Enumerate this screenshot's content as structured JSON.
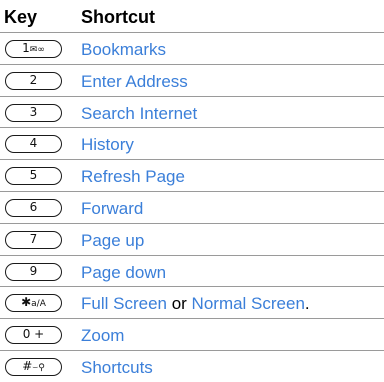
{
  "header": {
    "key_label": "Key",
    "shortcut_label": "Shortcut"
  },
  "rows": [
    {
      "key": "1",
      "key_suffix": "✉∞",
      "shortcut": "Bookmarks"
    },
    {
      "key": "2",
      "shortcut": "Enter Address"
    },
    {
      "key": "3",
      "shortcut": "Search Internet"
    },
    {
      "key": "4",
      "shortcut": "History"
    },
    {
      "key": "5",
      "shortcut": "Refresh Page"
    },
    {
      "key": "6",
      "shortcut": "Forward"
    },
    {
      "key": "7",
      "shortcut": "Page up"
    },
    {
      "key": "9",
      "shortcut": "Page down"
    },
    {
      "key": "✱",
      "key_suffix": "a/A",
      "shortcut_a": "Full Screen",
      "conjunction": " or ",
      "shortcut_b": "Normal Screen",
      "end": "."
    },
    {
      "key": "0 +",
      "shortcut": "Zoom"
    },
    {
      "key": "#",
      "key_suffix": "⌣⚲",
      "shortcut": "Shortcuts"
    }
  ],
  "colors": {
    "link": "#3b7fd9",
    "text": "#000000",
    "divider": "#9a9a9a"
  }
}
